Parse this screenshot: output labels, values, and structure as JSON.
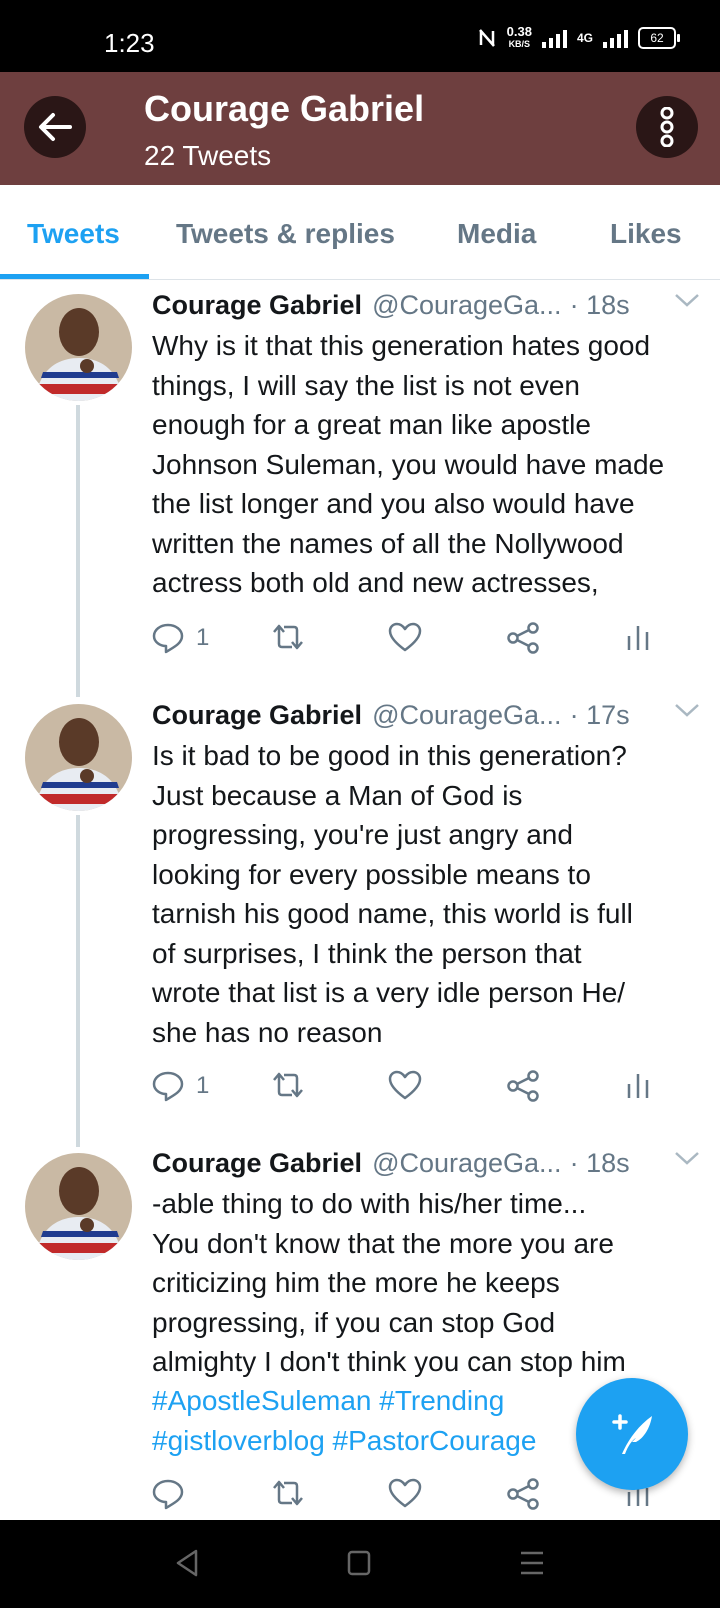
{
  "status_bar": {
    "time": "1:23",
    "speed_value": "0.38",
    "speed_unit": "KB/S",
    "network": "4G",
    "battery": "62"
  },
  "header": {
    "title": "Courage Gabriel",
    "subtitle": "22 Tweets"
  },
  "tabs": [
    {
      "label": "Tweets",
      "active": true
    },
    {
      "label": "Tweets & replies",
      "active": false
    },
    {
      "label": "Media",
      "active": false
    },
    {
      "label": "Likes",
      "active": false
    }
  ],
  "tweets": [
    {
      "name": "Courage Gabriel",
      "handle": "@CourageGa...",
      "time": "· 18s",
      "text": "Why is it that this generation hates good\nthings, I will say the list is not even\nenough for a great man like apostle\nJohnson Suleman, you would have made\nthe list longer and you also would have\nwritten the names of all the Nollywood\nactress both old and new actresses,",
      "hashtags": "",
      "reply_count": "1"
    },
    {
      "name": "Courage Gabriel",
      "handle": "@CourageGa...",
      "time": "· 17s",
      "text": "Is it bad to be good in this generation?\nJust because a Man of God is\nprogressing, you're just angry and\nlooking for every possible means to\ntarnish his good name, this world is full\nof surprises, I think the person that\nwrote that list is a very idle person He/\nshe has no reason",
      "hashtags": "",
      "reply_count": "1"
    },
    {
      "name": "Courage Gabriel",
      "handle": "@CourageGa...",
      "time": "· 18s",
      "text": "-able thing to do with his/her time...\nYou don't know that the more you are\ncriticizing him the more he keeps\nprogressing, if you can stop God\nalmighty I don't think you can stop him",
      "hashtags": "#ApostleSuleman #Trending\n#gistloverblog #PastorCourage",
      "reply_count": ""
    }
  ],
  "colors": {
    "accent": "#1da1f2",
    "header_bg": "#6e3f3f",
    "secondary_text": "#657786"
  },
  "icons": {
    "back": "arrow-left-icon",
    "more": "more-vertical-icon",
    "reply": "reply-icon",
    "retweet": "retweet-icon",
    "like": "heart-icon",
    "share": "share-icon",
    "analytics": "analytics-icon",
    "compose": "compose-tweet-icon"
  }
}
